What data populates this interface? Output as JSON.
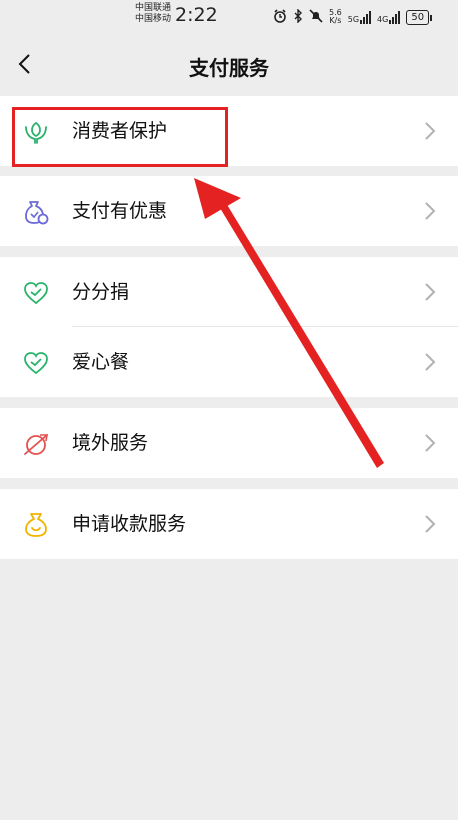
{
  "status_bar": {
    "carrier1": "中国联通",
    "carrier2": "中国移动",
    "time": "2:22",
    "net_speed_value": "5.6",
    "net_speed_unit": "K/s",
    "sig1": "5G",
    "sig2": "4G",
    "battery": "50"
  },
  "header": {
    "title": "支付服务"
  },
  "menu": [
    {
      "label": "消费者保护",
      "icon": "hands-protect-icon",
      "color": "#2bb36c"
    },
    {
      "label": "支付有优惠",
      "icon": "coupon-bag-icon",
      "color": "#6a6ad8"
    },
    {
      "label": "分分捐",
      "icon": "heart-check-icon",
      "color": "#2bb36c"
    },
    {
      "label": "爱心餐",
      "icon": "heart-check-icon",
      "color": "#2bb36c"
    },
    {
      "label": "境外服务",
      "icon": "globe-plane-icon",
      "color": "#e55050"
    },
    {
      "label": "申请收款服务",
      "icon": "money-bag-icon",
      "color": "#f0b400"
    }
  ],
  "annotation": {
    "color": "#e52222"
  }
}
